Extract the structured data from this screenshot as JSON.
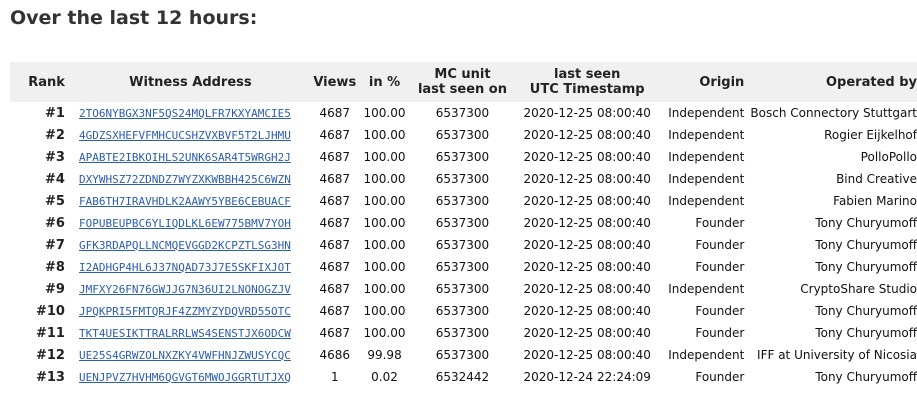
{
  "page": {
    "title": "Over the last 12 hours:"
  },
  "table": {
    "headers": {
      "rank": "Rank",
      "address": "Witness Address",
      "views": "Views",
      "pct": "in %",
      "mc_line1": "MC unit",
      "mc_line2": "last seen on",
      "ts_line1": "last seen",
      "ts_line2": "UTC Timestamp",
      "origin": "Origin",
      "operator": "Operated by"
    },
    "rows": [
      {
        "rank": "#1",
        "address": "2TO6NYBGX3NF5QS24MQLFR7KXYAMCIE5",
        "views": "4687",
        "pct": "100.00",
        "mc": "6537300",
        "ts": "2020-12-25 08:00:40",
        "origin": "Independent",
        "operator": "Bosch Connectory Stuttgart"
      },
      {
        "rank": "#2",
        "address": "4GDZSXHEFVFMHCUCSHZVXBVF5T2LJHMU",
        "views": "4687",
        "pct": "100.00",
        "mc": "6537300",
        "ts": "2020-12-25 08:00:40",
        "origin": "Independent",
        "operator": "Rogier Eijkelhof"
      },
      {
        "rank": "#3",
        "address": "APABTE2IBKOIHLS2UNK6SAR4T5WRGH2J",
        "views": "4687",
        "pct": "100.00",
        "mc": "6537300",
        "ts": "2020-12-25 08:00:40",
        "origin": "Independent",
        "operator": "PolloPollo"
      },
      {
        "rank": "#4",
        "address": "DXYWHSZ72ZDNDZ7WYZXKWBBH425C6WZN",
        "views": "4687",
        "pct": "100.00",
        "mc": "6537300",
        "ts": "2020-12-25 08:00:40",
        "origin": "Independent",
        "operator": "Bind Creative"
      },
      {
        "rank": "#5",
        "address": "FAB6TH7IRAVHDLK2AAWY5YBE6CEBUACF",
        "views": "4687",
        "pct": "100.00",
        "mc": "6537300",
        "ts": "2020-12-25 08:00:40",
        "origin": "Independent",
        "operator": "Fabien Marino"
      },
      {
        "rank": "#6",
        "address": "FOPUBEUPBC6YLIQDLKL6EW775BMV7YOH",
        "views": "4687",
        "pct": "100.00",
        "mc": "6537300",
        "ts": "2020-12-25 08:00:40",
        "origin": "Founder",
        "operator": "Tony Churyumoff"
      },
      {
        "rank": "#7",
        "address": "GFK3RDAPQLLNCMQEVGGD2KCPZTLSG3HN",
        "views": "4687",
        "pct": "100.00",
        "mc": "6537300",
        "ts": "2020-12-25 08:00:40",
        "origin": "Founder",
        "operator": "Tony Churyumoff"
      },
      {
        "rank": "#8",
        "address": "I2ADHGP4HL6J37NQAD73J7E5SKFIXJOT",
        "views": "4687",
        "pct": "100.00",
        "mc": "6537300",
        "ts": "2020-12-25 08:00:40",
        "origin": "Founder",
        "operator": "Tony Churyumoff"
      },
      {
        "rank": "#9",
        "address": "JMFXY26FN76GWJJG7N36UI2LNONOGZJV",
        "views": "4687",
        "pct": "100.00",
        "mc": "6537300",
        "ts": "2020-12-25 08:00:40",
        "origin": "Independent",
        "operator": "CryptoShare Studio"
      },
      {
        "rank": "#10",
        "address": "JPQKPRI5FMTQRJF4ZZMYZYDQVRD55OTC",
        "views": "4687",
        "pct": "100.00",
        "mc": "6537300",
        "ts": "2020-12-25 08:00:40",
        "origin": "Founder",
        "operator": "Tony Churyumoff"
      },
      {
        "rank": "#11",
        "address": "TKT4UESIKTTRALRRLWS4SENSTJX6ODCW",
        "views": "4687",
        "pct": "100.00",
        "mc": "6537300",
        "ts": "2020-12-25 08:00:40",
        "origin": "Founder",
        "operator": "Tony Churyumoff"
      },
      {
        "rank": "#12",
        "address": "UE25S4GRWZOLNXZKY4VWFHNJZWUSYCQC",
        "views": "4686",
        "pct": "99.98",
        "mc": "6537300",
        "ts": "2020-12-25 08:00:40",
        "origin": "Independent",
        "operator": "IFF at University of Nicosia"
      },
      {
        "rank": "#13",
        "address": "UENJPVZ7HVHM6QGVGT6MWOJGGRTUTJXQ",
        "views": "1",
        "pct": "0.02",
        "mc": "6532442",
        "ts": "2020-12-24 22:24:09",
        "origin": "Founder",
        "operator": "Tony Churyumoff"
      }
    ]
  }
}
